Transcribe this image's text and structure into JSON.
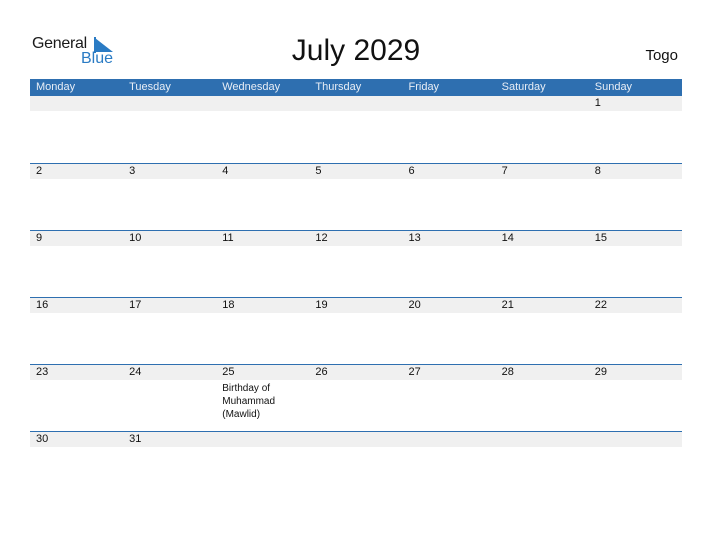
{
  "logo": {
    "line1": "General",
    "line2": "Blue"
  },
  "title": "July 2029",
  "country": "Togo",
  "colors": {
    "header_bg": "#2e6fb0",
    "accent": "#2a7bc4",
    "day_strip": "#f0f0f0"
  },
  "weekdays": [
    "Monday",
    "Tuesday",
    "Wednesday",
    "Thursday",
    "Friday",
    "Saturday",
    "Sunday"
  ],
  "weeks": [
    {
      "days": [
        "",
        "",
        "",
        "",
        "",
        "",
        "1"
      ],
      "events": [
        "",
        "",
        "",
        "",
        "",
        "",
        ""
      ]
    },
    {
      "days": [
        "2",
        "3",
        "4",
        "5",
        "6",
        "7",
        "8"
      ],
      "events": [
        "",
        "",
        "",
        "",
        "",
        "",
        ""
      ]
    },
    {
      "days": [
        "9",
        "10",
        "11",
        "12",
        "13",
        "14",
        "15"
      ],
      "events": [
        "",
        "",
        "",
        "",
        "",
        "",
        ""
      ]
    },
    {
      "days": [
        "16",
        "17",
        "18",
        "19",
        "20",
        "21",
        "22"
      ],
      "events": [
        "",
        "",
        "",
        "",
        "",
        "",
        ""
      ]
    },
    {
      "days": [
        "23",
        "24",
        "25",
        "26",
        "27",
        "28",
        "29"
      ],
      "events": [
        "",
        "",
        "Birthday of Muhammad (Mawlid)",
        "",
        "",
        "",
        ""
      ]
    },
    {
      "days": [
        "30",
        "31",
        "",
        "",
        "",
        "",
        ""
      ],
      "events": [
        "",
        "",
        "",
        "",
        "",
        "",
        ""
      ]
    }
  ]
}
